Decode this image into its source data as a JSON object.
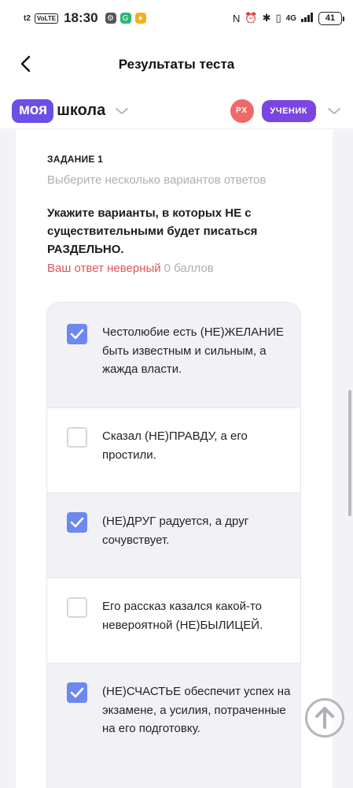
{
  "status_bar": {
    "carrier": "t2",
    "volte": "VoLTE",
    "time": "18:30",
    "network": "4G",
    "battery": "41"
  },
  "header": {
    "title": "Результаты теста"
  },
  "brand": {
    "logo_pill": "моя",
    "logo_word": "школа",
    "avatar_initials": "РХ",
    "role_label": "УЧЕНИК"
  },
  "task": {
    "label": "ЗАДАНИЕ 1",
    "hint": "Выберите несколько вариантов ответов",
    "question": "Укажите варианты, в которых НЕ с существительными будет писаться РАЗДЕЛЬНО.",
    "result_text": "Ваш ответ неверный",
    "score_text": "0 баллов"
  },
  "options": [
    {
      "text": "Честолюбие есть (НЕ)ЖЕЛАНИЕ быть известным и сильным, а жажда власти.",
      "checked": true
    },
    {
      "text": "Сказал (НЕ)ПРАВДУ, а его простили.",
      "checked": false
    },
    {
      "text": "(НЕ)ДРУГ радуется, а друг сочувствует.",
      "checked": true
    },
    {
      "text": "Его рассказ казался какой-то невероятной (НЕ)БЫЛИЦЕЙ.",
      "checked": false
    },
    {
      "text": "(НЕ)СЧАСТЬЕ обеспечит успех на экзамене, а усилия, потраченные на его подготовку.",
      "checked": true
    }
  ],
  "colors": {
    "brand_purple": "#6d4ee6",
    "role_purple": "#7a45e0",
    "avatar_red": "#ee6a6a",
    "checkbox_blue": "#6e88ee",
    "error_red": "#e05656"
  }
}
